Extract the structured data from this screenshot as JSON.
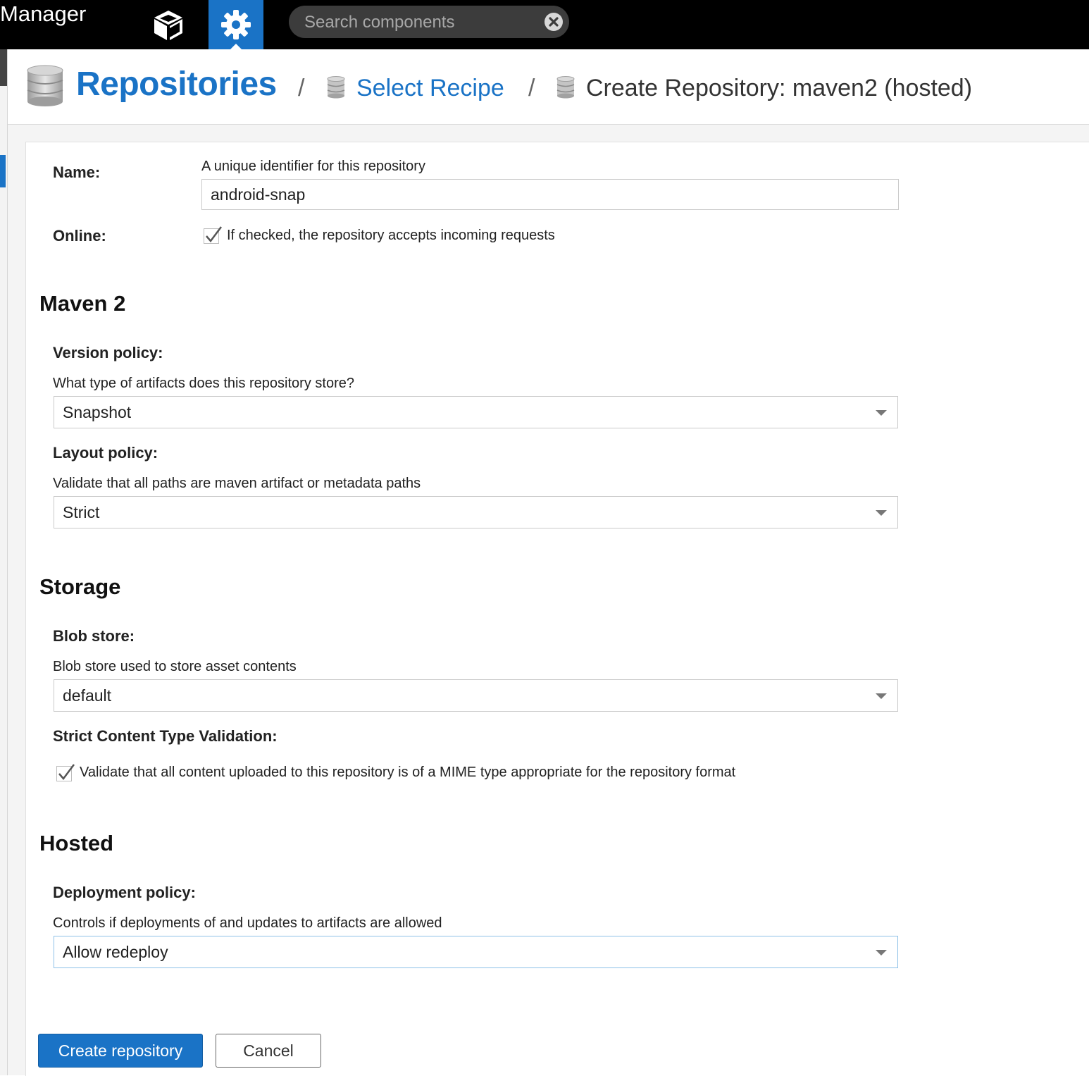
{
  "app": {
    "title": "Manager"
  },
  "topbar": {
    "browse_icon": "cube-icon",
    "admin_icon": "gear-icon",
    "search": {
      "placeholder": "Search components",
      "value": ""
    },
    "clear_icon": "close-circle-icon"
  },
  "breadcrumb": {
    "root": "Repositories",
    "separator": "/",
    "recipe": "Select Recipe",
    "current": "Create Repository: maven2 (hosted)",
    "icon": "database-icon"
  },
  "form": {
    "name": {
      "label": "Name:",
      "help": "A unique identifier for this repository",
      "value": "android-snap"
    },
    "online": {
      "label": "Online:",
      "help": "If checked, the repository accepts incoming requests",
      "checked": true
    },
    "maven": {
      "heading": "Maven 2",
      "version_policy": {
        "label": "Version policy:",
        "help": "What type of artifacts does this repository store?",
        "value": "Snapshot"
      },
      "layout_policy": {
        "label": "Layout policy:",
        "help": "Validate that all paths are maven artifact or metadata paths",
        "value": "Strict"
      }
    },
    "storage": {
      "heading": "Storage",
      "blob_store": {
        "label": "Blob store:",
        "help": "Blob store used to store asset contents",
        "value": "default"
      },
      "strict_content": {
        "label": "Strict Content Type Validation:",
        "help": "Validate that all content uploaded to this repository is of a MIME type appropriate for the repository format",
        "checked": true
      }
    },
    "hosted": {
      "heading": "Hosted",
      "deployment_policy": {
        "label": "Deployment policy:",
        "help": "Controls if deployments of and updates to artifacts are allowed",
        "value": "Allow redeploy"
      }
    },
    "buttons": {
      "create": "Create repository",
      "cancel": "Cancel"
    }
  },
  "colors": {
    "accent": "#1a73c6",
    "topbar": "#000000"
  }
}
